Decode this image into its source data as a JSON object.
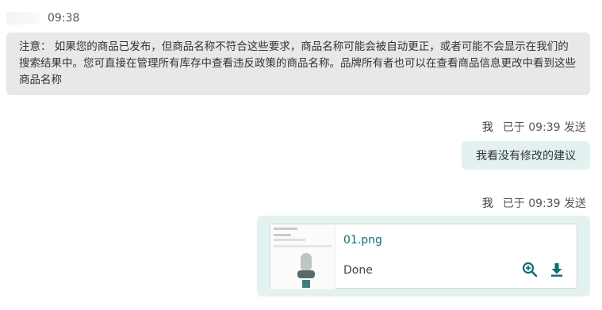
{
  "incoming": {
    "time": "09:38",
    "text": "注意： 如果您的商品已发布，但商品名称不符合这些要求，商品名称可能会被自动更正，或者可能不会显示在我们的搜索结果中。您可直接在管理所有库存中查看违反政策的商品名称。品牌所有者也可以在查看商品信息更改中看到这些商品名称"
  },
  "outgoing_messages": [
    {
      "sender": "我",
      "status": "已于 09:39 发送",
      "text": "我看没有修改的建议"
    },
    {
      "sender": "我",
      "status": "已于 09:39 发送",
      "attachment": {
        "filename": "01.png",
        "status": "Done"
      }
    }
  ],
  "icons": {
    "zoom": "zoom-in-icon",
    "download": "download-icon"
  },
  "colors": {
    "incoming_bubble": "#e8e8e8",
    "outgoing_bubble": "#e3f1f1",
    "accent": "#0f6e72"
  }
}
